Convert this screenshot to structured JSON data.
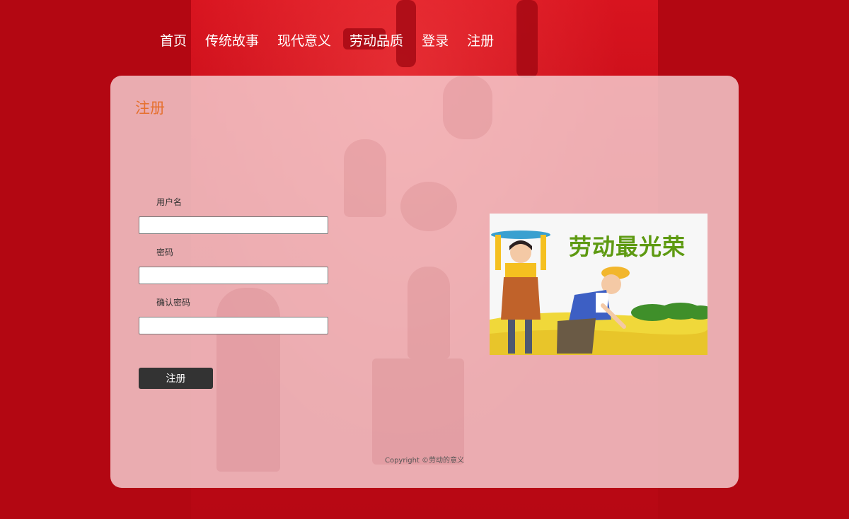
{
  "nav": {
    "items": [
      "首页",
      "传统故事",
      "现代意义",
      "劳动品质",
      "登录",
      "注册"
    ]
  },
  "form": {
    "title": "注册",
    "username_label": "用户名",
    "password_label": "密码",
    "confirm_label": "确认密码",
    "username_value": "",
    "password_value": "",
    "confirm_value": "",
    "submit_label": "注册"
  },
  "illustration": {
    "title": "劳动最光荣"
  },
  "footer": {
    "copyright": "Copyright ©劳动的意义"
  },
  "colors": {
    "page_bg": "#b30712",
    "panel_bg": "#f8d6d8",
    "title_accent": "#e6702e",
    "button_bg": "#333333"
  }
}
